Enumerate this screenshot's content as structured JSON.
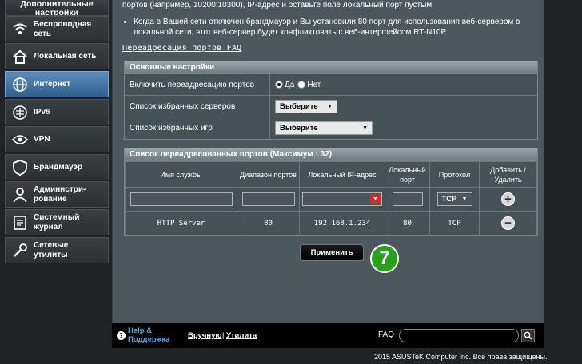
{
  "sidebar": {
    "header": "Дополнительные\nнастройки",
    "items": [
      {
        "label": "Беспроводная\nсеть",
        "icon": "wifi-icon"
      },
      {
        "label": "Локальная сеть",
        "icon": "home-icon"
      },
      {
        "label": "Интернет",
        "icon": "globe-icon"
      },
      {
        "label": "IPv6",
        "icon": "ipv6-icon"
      },
      {
        "label": "VPN",
        "icon": "vpn-icon"
      },
      {
        "label": "Брандмауэр",
        "icon": "shield-icon"
      },
      {
        "label": "Администри-\nрование",
        "icon": "admin-icon"
      },
      {
        "label": "Системный\nжурнал",
        "icon": "log-icon"
      },
      {
        "label": "Сетевые\nутилиты",
        "icon": "tools-icon"
      }
    ],
    "active_index": 2
  },
  "intro": {
    "line1": "портов (например, 10200:10300), IP-адрес и оставьте поле локальный порт пустым.",
    "bullet1": "Когда в Вашей сети отключен брандмауэр и Вы установили 80 порт для использования веб-сервером в локальной сети, этот веб-сервер будет конфликтовать с веб-интерфейсом RT-N10P.",
    "faq_link": "Переадресация портов FAQ"
  },
  "basic": {
    "title": "Основные настройки",
    "enable_label": "Включить переадресацию портов",
    "yes": "Да",
    "no": "Нет",
    "servers_label": "Список избранных серверов",
    "servers_value": "Выберите",
    "games_label": "Список избранных игр",
    "games_value": "Выберите"
  },
  "ports": {
    "title": "Список переадресованных портов (Максимум : 32)",
    "headers": [
      "Имя службы",
      "Диапазон портов",
      "Локальный IP-адрес",
      "Локальный\nпорт",
      "Протокол",
      "Добавить /\nУдалить"
    ],
    "new_protocol": "TCP",
    "rows": [
      {
        "service": "HTTP Server",
        "range": "80",
        "ip": "192.168.1.234",
        "local_port": "80",
        "protocol": "TCP"
      }
    ]
  },
  "apply_label": "Применить",
  "step_number": "7",
  "footer": {
    "help": "Help &\nПоддержка",
    "manual": "Вручную",
    "sep": "|",
    "utility": "Утилита",
    "faq": "FAQ",
    "copyright": "2015 ASUSTeK Computer Inc. Все права защищены."
  }
}
